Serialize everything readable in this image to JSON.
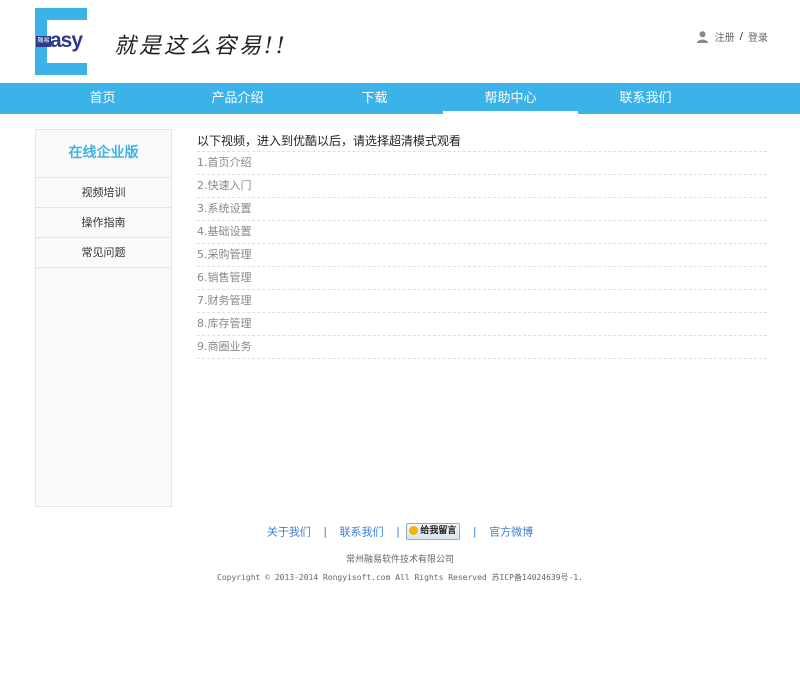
{
  "header": {
    "logo": {
      "tag": "融易",
      "word": "asy"
    },
    "slogan": "就是这么容易!!",
    "user_links": {
      "register": "注册",
      "separator": "/",
      "login": "登录"
    }
  },
  "nav": {
    "items": [
      {
        "label": "首页"
      },
      {
        "label": "产品介绍"
      },
      {
        "label": "下载"
      },
      {
        "label": "帮助中心",
        "active": true
      },
      {
        "label": "联系我们"
      }
    ]
  },
  "sidebar": {
    "title": "在线企业版",
    "items": [
      {
        "label": "视频培训"
      },
      {
        "label": "操作指南"
      },
      {
        "label": "常见问题"
      }
    ]
  },
  "main": {
    "title": "以下视频，进入到优酷以后，请选择超清模式观看",
    "items": [
      {
        "label": "1.首页介绍"
      },
      {
        "label": "2.快速入门"
      },
      {
        "label": "3.系统设置"
      },
      {
        "label": "4.基础设置"
      },
      {
        "label": "5.采购管理"
      },
      {
        "label": "6.销售管理"
      },
      {
        "label": "7.财务管理"
      },
      {
        "label": "8.库存管理"
      },
      {
        "label": "9.商圈业务"
      }
    ]
  },
  "footer": {
    "links": {
      "about": "关于我们",
      "contact": "联系我们",
      "message_button": "给我留言",
      "weibo": "官方微博",
      "separator": "|"
    },
    "company": "常州融易软件技术有限公司",
    "copyright": "Copyright © 2013-2014 Rongyisoft.com All Rights Reserved 苏ICP备14024639号-1."
  },
  "colors": {
    "accent": "#3bb3e8",
    "logo_dark": "#2d3a8c",
    "link": "#3b7fd4"
  }
}
